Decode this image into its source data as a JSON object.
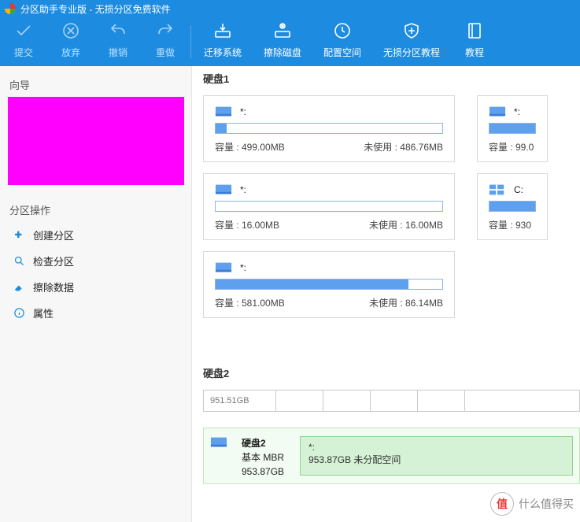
{
  "title": "分区助手专业版 - 无损分区免费软件",
  "toolbar": [
    {
      "id": "commit",
      "label": "提交",
      "enabled": false,
      "icon": "check"
    },
    {
      "id": "discard",
      "label": "放弃",
      "enabled": false,
      "icon": "xcircle"
    },
    {
      "id": "undo",
      "label": "撤销",
      "enabled": false,
      "icon": "undo"
    },
    {
      "id": "redo",
      "label": "重做",
      "enabled": false,
      "icon": "redo"
    },
    {
      "id": "migrate",
      "label": "迁移系统",
      "enabled": true,
      "icon": "drive-arrow",
      "sep_before": true
    },
    {
      "id": "wipe",
      "label": "擦除磁盘",
      "enabled": true,
      "icon": "erase"
    },
    {
      "id": "space",
      "label": "配置空间",
      "enabled": true,
      "icon": "clock"
    },
    {
      "id": "tutorial",
      "label": "无损分区教程",
      "enabled": true,
      "icon": "shield"
    },
    {
      "id": "help",
      "label": "教程",
      "enabled": true,
      "icon": "book"
    }
  ],
  "sidebar": {
    "wizard_title": "向导",
    "ops_title": "分区操作",
    "ops": [
      {
        "id": "create",
        "label": "创建分区",
        "icon": "puzzle",
        "color": "#1d8ce0"
      },
      {
        "id": "check",
        "label": "检查分区",
        "icon": "search",
        "color": "#1d8ce0"
      },
      {
        "id": "erase",
        "label": "擦除数据",
        "icon": "eraser",
        "color": "#1d8ce0"
      },
      {
        "id": "props",
        "label": "属性",
        "icon": "info",
        "color": "#1d8ce0"
      }
    ]
  },
  "disks": {
    "d1": {
      "title": "硬盘1",
      "rows": [
        [
          {
            "label": "*:",
            "cap_k": "容量",
            "cap_v": "499.00MB",
            "free_k": "未使用",
            "free_v": "486.76MB",
            "fill": "5%",
            "icon": "drive"
          },
          {
            "label": "*:",
            "cap_k": "容量",
            "cap_v": "99.0",
            "fill": "100%",
            "icon": "drive"
          }
        ],
        [
          {
            "label": "*:",
            "cap_k": "容量",
            "cap_v": "16.00MB",
            "free_k": "未使用",
            "free_v": "16.00MB",
            "fill": "0%",
            "icon": "drive"
          },
          {
            "label": "C:",
            "cap_k": "容量",
            "cap_v": "930",
            "fill": "100%",
            "icon": "win"
          }
        ],
        [
          {
            "label": "*:",
            "cap_k": "容量",
            "cap_v": "581.00MB",
            "free_k": "未使用",
            "free_v": "86.14MB",
            "fill": "85%",
            "icon": "drive"
          }
        ]
      ]
    },
    "d2": {
      "title": "硬盘2",
      "bar_label": "951.51GB",
      "row": {
        "name": "硬盘2",
        "type": "基本 MBR",
        "size": "953.87GB",
        "alloc_label": "*:",
        "alloc_text": "953.87GB 未分配空间"
      }
    }
  },
  "watermark": {
    "char": "值",
    "text": "什么值得买"
  }
}
